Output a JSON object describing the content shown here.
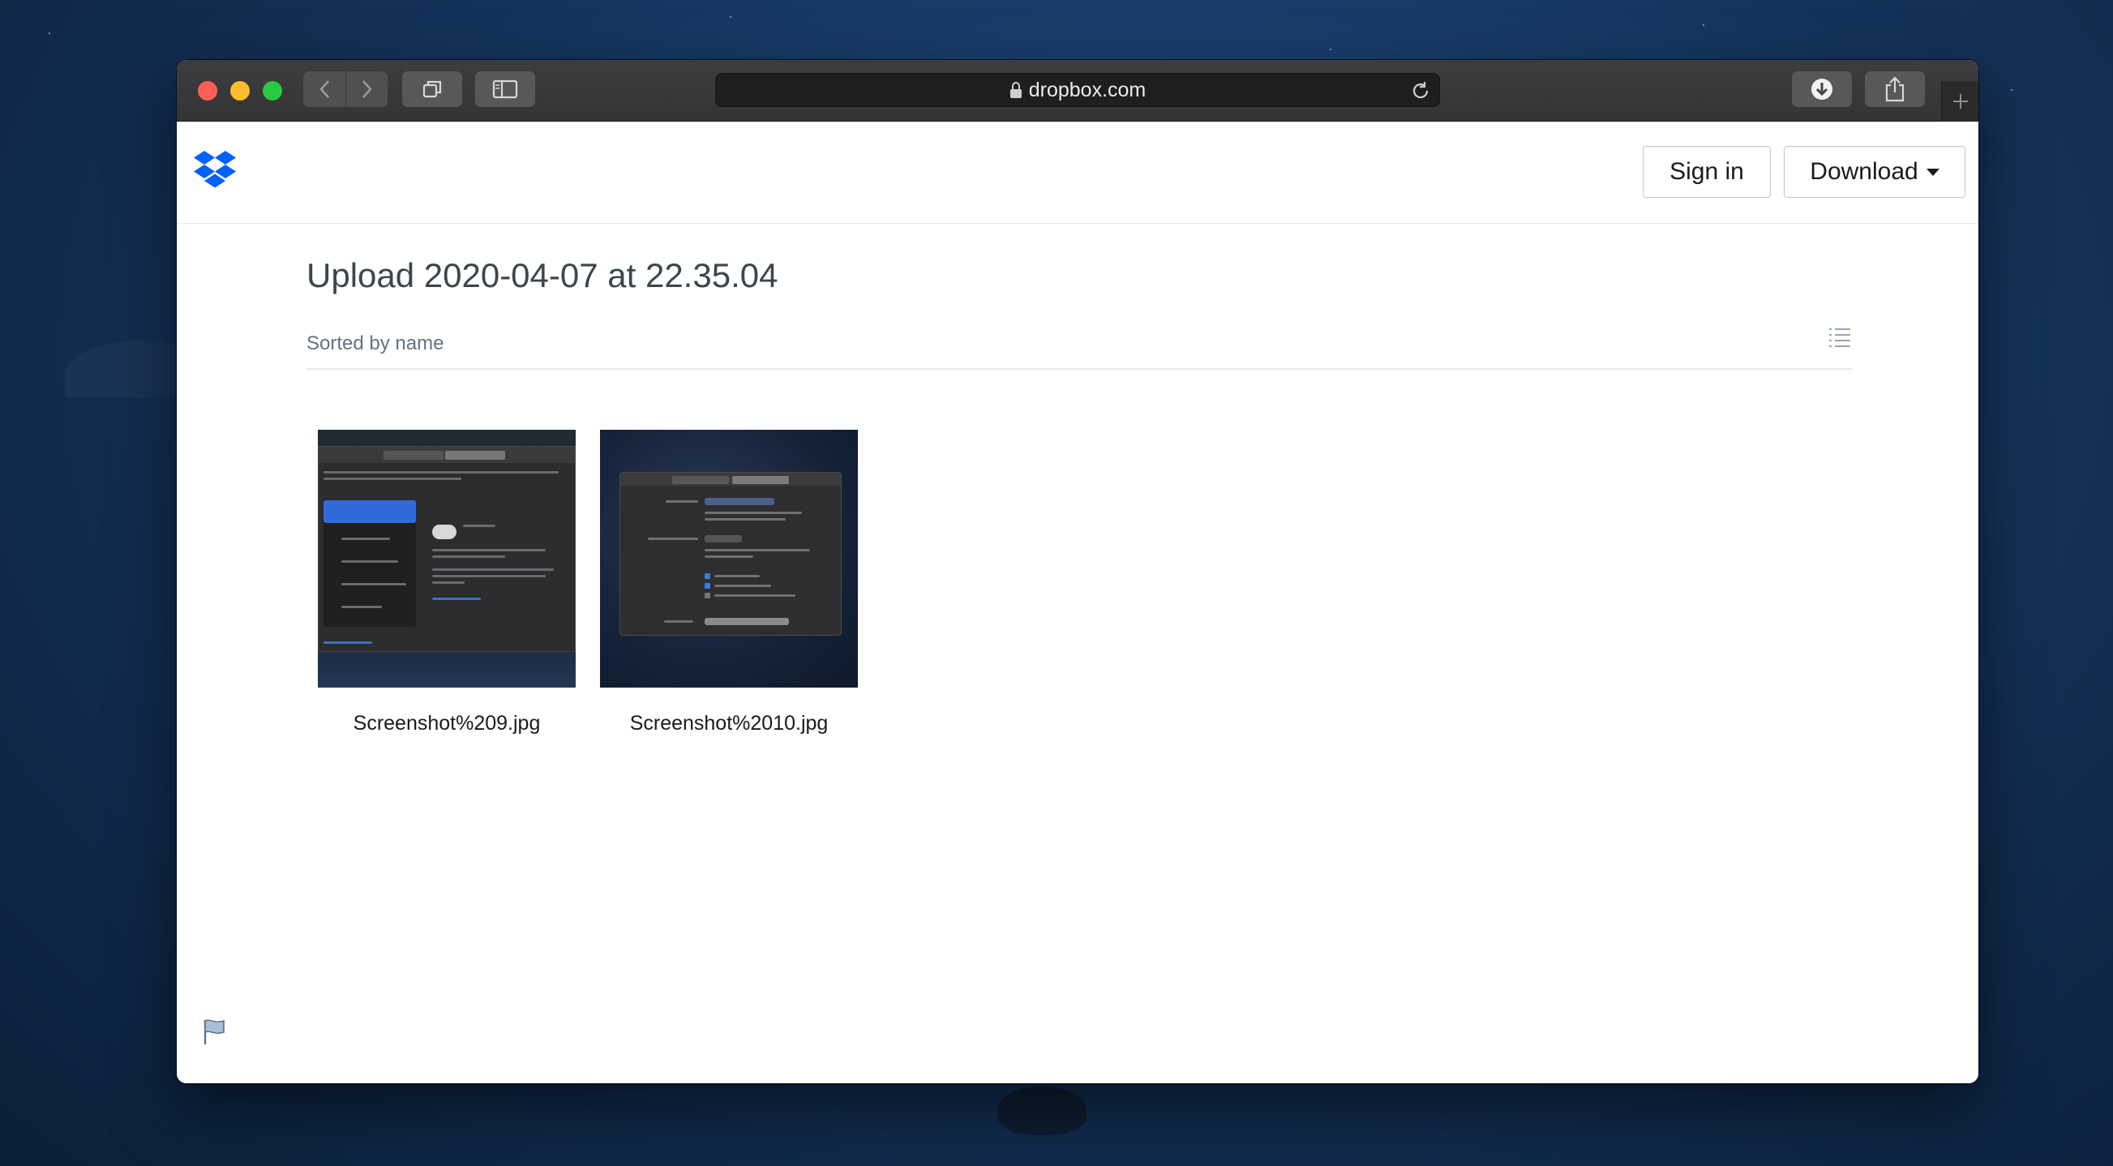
{
  "browser": {
    "url": "dropbox.com",
    "icons": {
      "back": "chevron-left-icon",
      "forward": "chevron-right-icon",
      "tabs": "tab-overview-icon",
      "sidebar": "sidebar-icon",
      "lock": "lock-icon",
      "reload": "reload-icon",
      "downloads": "download-arrow-icon",
      "share": "share-icon",
      "new_tab": "plus-icon"
    }
  },
  "header": {
    "sign_in_label": "Sign in",
    "download_label": "Download",
    "brand_color": "#0061fe"
  },
  "folder": {
    "title": "Upload 2020-04-07 at 22.35.04",
    "sort_label": "Sorted by name"
  },
  "files": [
    {
      "name": "Screenshot%209.jpg"
    },
    {
      "name": "Screenshot%2010.jpg"
    }
  ]
}
